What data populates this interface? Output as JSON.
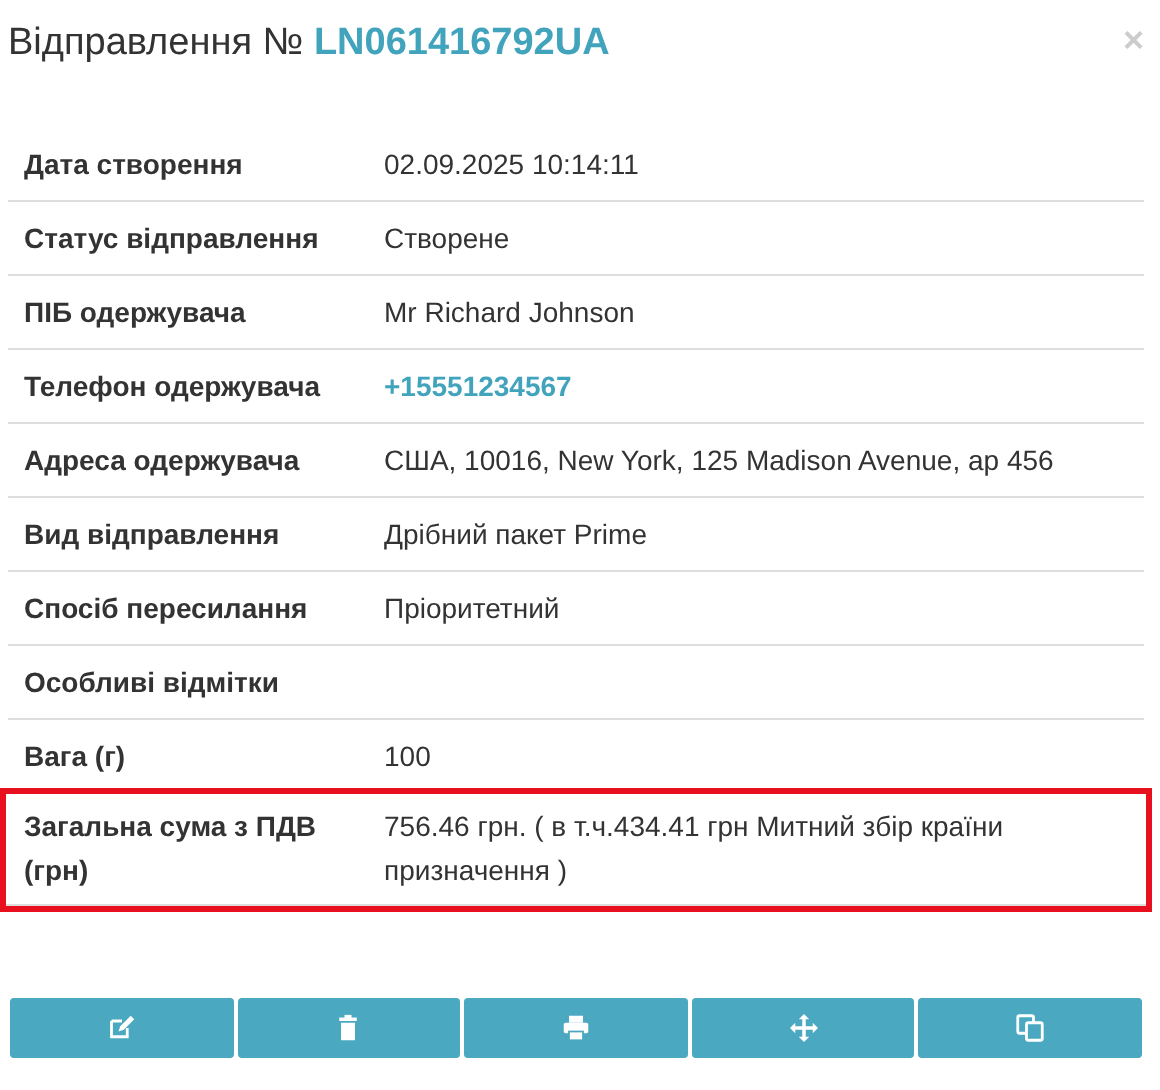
{
  "title": {
    "label": "Відправлення №",
    "number": "LN061416792UA"
  },
  "close": "×",
  "rows": [
    {
      "label": "Дата створення",
      "value": "02.09.2025 10:14:11",
      "kind": "text",
      "highlighted": false
    },
    {
      "label": "Статус відправлення",
      "value": "Створене",
      "kind": "text",
      "highlighted": false
    },
    {
      "label": "ПІБ одержувача",
      "value": "Mr Richard Johnson",
      "kind": "text",
      "highlighted": false
    },
    {
      "label": "Телефон одержувача",
      "value": "+15551234567",
      "kind": "link",
      "highlighted": false
    },
    {
      "label": "Адреса одержувача",
      "value": "США, 10016, New York, 125 Madison Avenue, ap 456",
      "kind": "text",
      "highlighted": false
    },
    {
      "label": "Вид відправлення",
      "value": "Дрібний пакет Prime",
      "kind": "text",
      "highlighted": false
    },
    {
      "label": "Спосіб пересилання",
      "value": "Пріоритетний",
      "kind": "text",
      "highlighted": false
    },
    {
      "label": "Особливі відмітки",
      "highlighted": false
    },
    {
      "label": "Вага (г)",
      "value": "100",
      "kind": "text",
      "highlighted": false
    },
    {
      "label": "Загальна сума з ПДВ (грн)",
      "value": "756.46 грн. ( в т.ч.434.41 грн Митний збір країни призначення )",
      "kind": "text",
      "highlighted": true
    }
  ],
  "actions": [
    {
      "kind": "edit"
    },
    {
      "kind": "delete"
    },
    {
      "kind": "print"
    },
    {
      "kind": "move"
    },
    {
      "kind": "copy"
    }
  ]
}
